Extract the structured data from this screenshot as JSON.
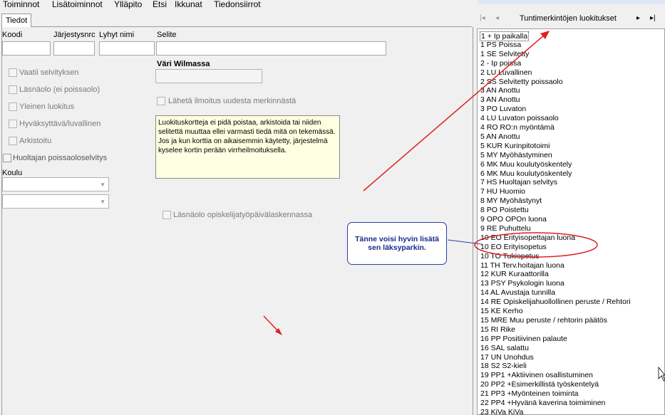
{
  "menu": [
    "Toiminnot",
    "Lisätoiminnot",
    "Ylläpito",
    "Etsi",
    "Ikkunat",
    "Tiedonsiirrot"
  ],
  "tab_label": "Tiedot",
  "fields": {
    "koodi": "Koodi",
    "jarjestysnro": "Järjestysnro",
    "lyhyt_nimi": "Lyhyt nimi",
    "selite": "Selite",
    "vari_wilmassa": "Väri Wilmassa",
    "koulu": "Koulu"
  },
  "checkboxes": {
    "vaatii": "Vaatii selvityksen",
    "lasnaolo": "Läsnäolo (ei poissaolo)",
    "yleinen": "Yleinen luokitus",
    "hyvaksyttava": "Hyväksyttävä/luvallinen",
    "arkistoitu": "Arkistoitu",
    "huoltajan": "Huoltajan poissaoloselvitys",
    "laheta": "Lähetä ilmoitus uudesta merkinnästä",
    "lasnaolo_opisk": "Läsnäolo opiskelijatyöpäivälaskennassa"
  },
  "note_text": "Luokituskortteja ei pidä poistaa, arkistoida tai niiden selitettä muuttaa ellei varmasti tiedä mitä on tekemässä. Jos ja kun korttia on aikaisemmin käytetty, järjestelmä kyselee kortin perään virrheilmoituksella.",
  "list_title": "Tuntimerkintöjen luokitukset",
  "nav": {
    "first": "|◂",
    "prev": "◂",
    "next": "▸",
    "last": "▸|"
  },
  "list_items": [
    "1 + Ip paikalla",
    "1 PS Poissa",
    "1 SE Selvitetty",
    "2 - Ip poissa",
    "2 LU Luvallinen",
    "2 SS Selvitetty poissaolo",
    "3 AN Anottu",
    "3 AN Anottu",
    "3 PO Luvaton",
    "4 LU Luvaton poissaolo",
    "4 RO RO:n myöntämä",
    "5 AN Anottu",
    "5 KUR Kurinpitotoimi",
    "5 MY Myöhästyminen",
    "6 MK Muu koulutyöskentely",
    "6 MK Muu koulutyöskentely",
    "7 HS Huoltajan selvitys",
    "7 HU Huomio",
    "8 MY Myöhästynyt",
    "8 PO Poistettu",
    "9 OPO OPOn luona",
    "9 RE Puhuttelu",
    "10 EO Erityisopettajan luona",
    "10 EO Erityisopetus",
    "10 TO Tukiopetus",
    "11 TH Terv.hoitajan luona",
    "12 KUR Kuraattorilla",
    "13 PSY Psykologin luona",
    "14 AL Avustaja tunnilla",
    "14 RE Opiskelijahuollollinen peruste / Rehtori",
    "15 KE Kerho",
    "15 MRE Muu peruste / rehtorin päätös",
    "15 RI Rike",
    "16 PP Positiivinen palaute",
    "16 SAL salattu",
    "17 UN Unohdus",
    "18 S2 S2-kieli",
    "19 PP1 +Aktiivinen osallistuminen",
    "20 PP2 +Esimerkillistä työskentelyä",
    "21 PP3 +Myönteinen toiminta",
    "22 PP4 +Hyvänä kaverina toimiminen",
    "23 KiVa KiVa"
  ],
  "callout_text": "Tänne voisi hyvin lisätä sen läksyparkin.",
  "colors": {
    "annotation_red": "#e02020",
    "callout_blue": "#2b3ea8",
    "note_bg": "#ffffe1"
  }
}
